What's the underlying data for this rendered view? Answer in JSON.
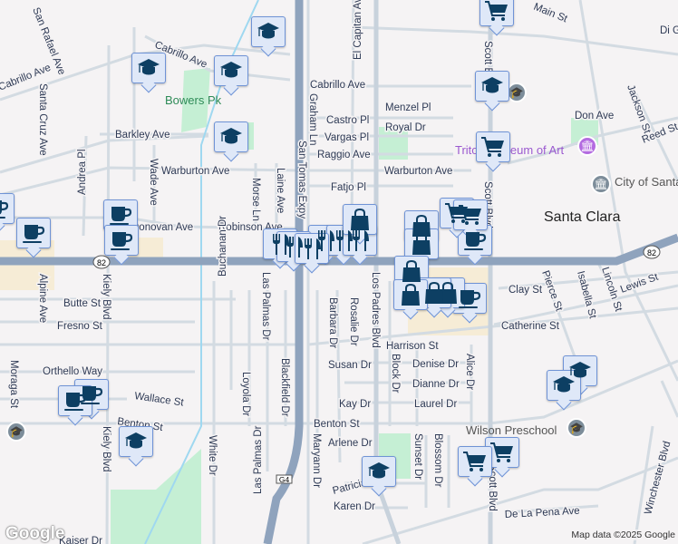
{
  "map": {
    "streets": [
      "Cabrillo Ave",
      "Cabrillo Ave",
      "Cabrillo Ave",
      "Barkley Ave",
      "Warburton Ave",
      "Warburton Ave",
      "Robinson Ave",
      "Donovan Ave",
      "Andrea Pl",
      "Wade Ave",
      "Morse Ln",
      "Laine Ave",
      "San Tomas Expy",
      "Graham Ln",
      "Castro Pl",
      "Vargas Pl",
      "Raggio Ave",
      "Fatjo Pl",
      "Menzel Pl",
      "Royal Dr",
      "El Capitan Ave",
      "Scott Blvd",
      "Scott Blvd",
      "Main St",
      "Don Ave",
      "Jackson St",
      "Reed St",
      "Santa Cruz Ave",
      "San Rafael Ave",
      "Kiely Blvd",
      "Kiely Blvd",
      "Alpine Ave",
      "Butte St",
      "Fresno St",
      "Orthello Way",
      "Moraga St",
      "Wallace St",
      "Benton St",
      "Benton St",
      "White Dr",
      "Buchanan Dr",
      "Las Palmas Dr",
      "Las Palmas Dr",
      "Loyola Dr",
      "Blackfield Dr",
      "Maryann Dr",
      "Barbara Dr",
      "Rosalie Dr",
      "Los Padres Blvd",
      "Block Dr",
      "Alice Dr",
      "Harrison St",
      "Susan Dr",
      "Denise Dr",
      "Dianne Dr",
      "Kay Dr",
      "Laurel Dr",
      "Arlene Dr",
      "Sunset Dr",
      "Blossom Dr",
      "Patricia Dr",
      "Karen Dr",
      "De La Pena Ave",
      "Clay St",
      "Catherine St",
      "Pierce St",
      "Isabella St",
      "Lincoln St",
      "Lewis St",
      "Winchester Blvd",
      "Scott Blvd",
      "Kaiser Dr",
      "Di Gi"
    ],
    "park": "Bowers Pk",
    "city": "Santa Clara",
    "pois": {
      "museum": "Triton Museum of Art",
      "city_hall": "City of Santa Clara City Hall",
      "preschool": "Wilson Preschool"
    },
    "shields": {
      "hwy82": "82",
      "g4": "G4"
    },
    "markers_legend": [
      "school-icon",
      "coffee-icon",
      "restaurant-icon",
      "shopping-bag-icon",
      "shopping-cart-icon"
    ],
    "colors": {
      "highway": "#8fa3bd",
      "street": "#d3dbe2",
      "marker_bg": "#dfe8f8",
      "marker_border": "#6f93d6",
      "icon": "#0d3f63",
      "park": "#c5efd4"
    }
  },
  "footer": {
    "logo": "Google",
    "attribution": "Map data ©2025 Google"
  }
}
